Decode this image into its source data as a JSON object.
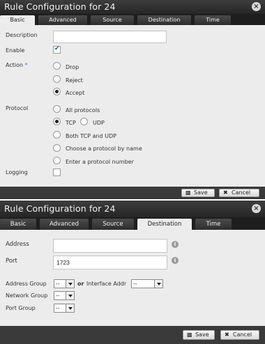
{
  "dialog1": {
    "title": "Rule Configuration for 24",
    "close_label": "×",
    "tabs": [
      "Basic",
      "Advanced",
      "Source",
      "Destination",
      "Time"
    ],
    "active_tab": "Basic",
    "description_label": "Description",
    "description_value": "",
    "enable_label": "Enable",
    "enable_checked": true,
    "action_label": "Action",
    "required_marker": "*",
    "action_options": [
      "Drop",
      "Reject",
      "Accept"
    ],
    "action_selected": "Accept",
    "protocol_label": "Protocol",
    "protocol_options": {
      "all": "All protocols",
      "tcp": "TCP",
      "udp": "UDP",
      "both": "Both TCP and UDP",
      "by_name": "Choose a protocol by name",
      "by_number": "Enter a protocol number"
    },
    "protocol_selected": "TCP",
    "logging_label": "Logging",
    "logging_checked": false,
    "save_label": "Save",
    "cancel_label": "Cancel"
  },
  "dialog2": {
    "title": "Rule Configuration for 24",
    "close_label": "×",
    "tabs": [
      "Basic",
      "Advanced",
      "Source",
      "Destination",
      "Time"
    ],
    "active_tab": "Destination",
    "address_label": "Address",
    "address_value": "",
    "port_label": "Port",
    "port_value": "1723",
    "info_glyph": "i",
    "address_group_label": "Address Group",
    "address_group_value": "--",
    "or_label": "or",
    "interface_addr_label": "Interface Addr",
    "interface_addr_value": "--",
    "network_group_label": "Network Group",
    "network_group_value": "--",
    "port_group_label": "Port Group",
    "port_group_value": "--",
    "save_label": "Save",
    "cancel_label": "Cancel"
  },
  "icons": {
    "save": "save-icon",
    "cancel": "cancel-x-icon",
    "info": "info-icon",
    "close": "close-icon"
  },
  "colors": {
    "titlebar": "#2e2e2e",
    "tabbar": "#1e1e1e",
    "panel": "#ececec",
    "required_asterisk": "#2e7bd6"
  }
}
